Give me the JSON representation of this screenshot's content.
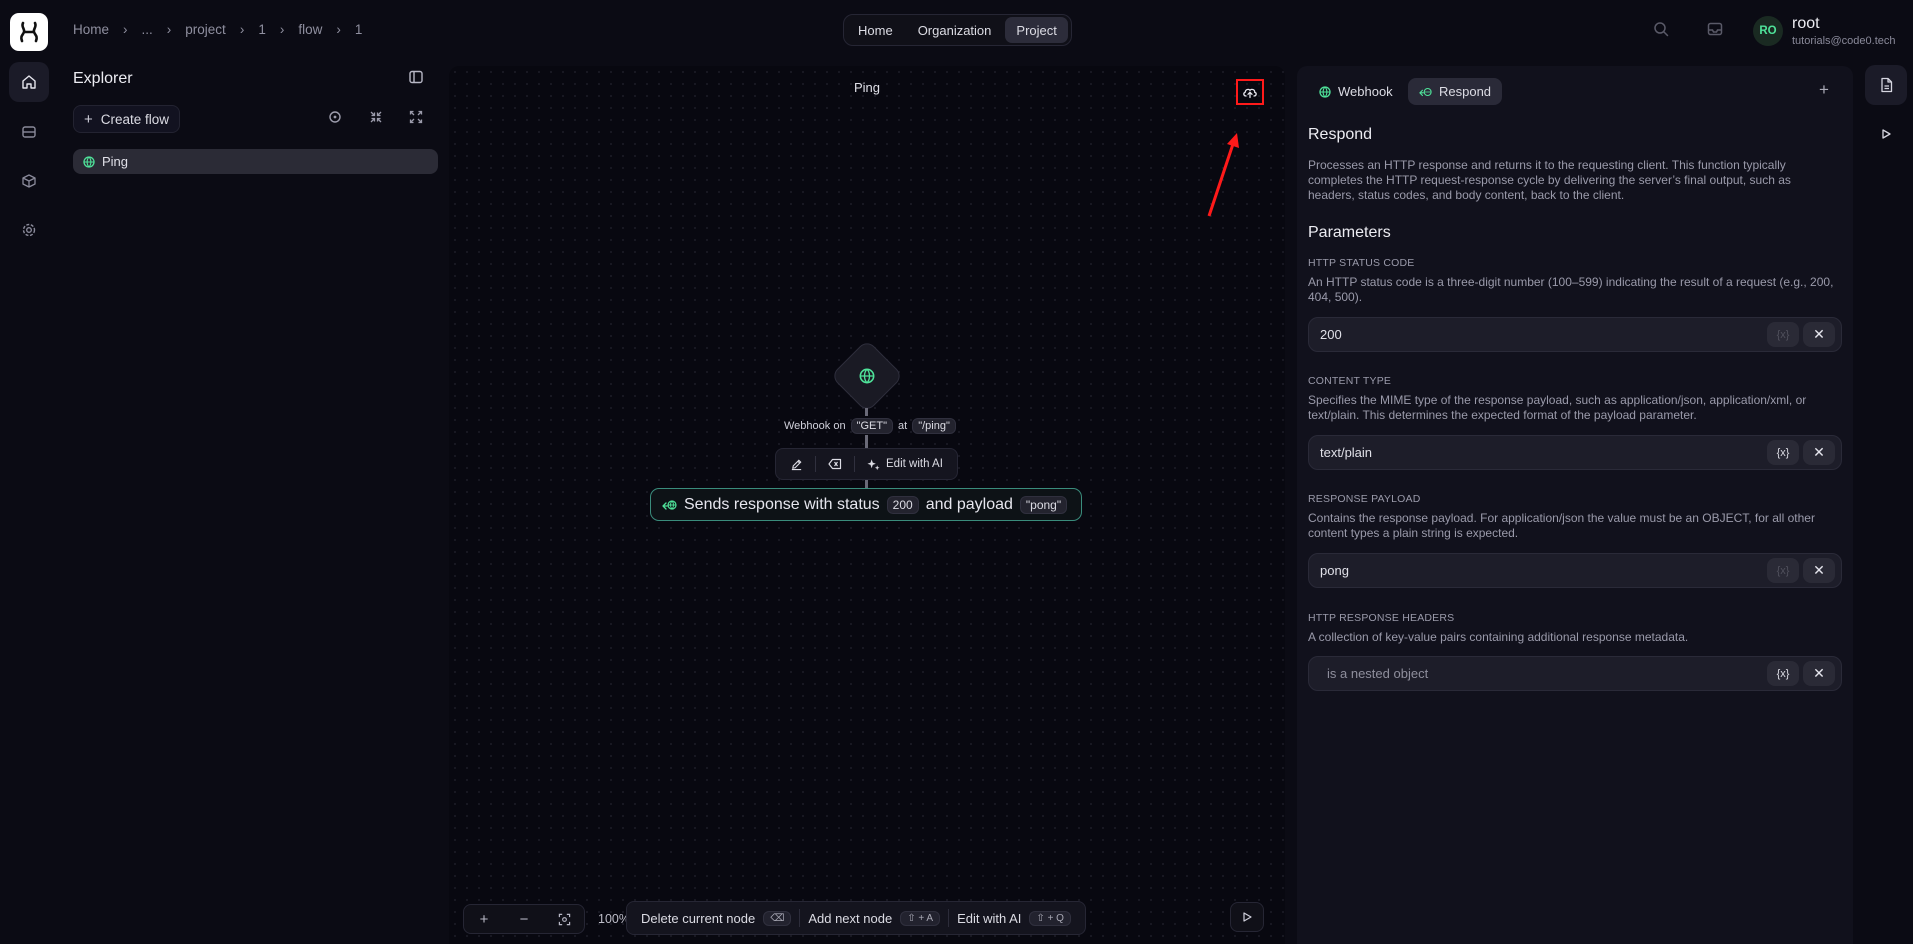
{
  "breadcrumb": [
    "Home",
    "...",
    "project",
    "1",
    "flow",
    "1"
  ],
  "topnav": [
    {
      "label": "Home",
      "active": false
    },
    {
      "label": "Organization",
      "active": false
    },
    {
      "label": "Project",
      "active": true
    }
  ],
  "user": {
    "initials": "RO",
    "name": "root",
    "email": "tutorials@code0.tech"
  },
  "explorer": {
    "title": "Explorer",
    "create_label": "Create flow",
    "flows": [
      {
        "name": "Ping",
        "icon": "webhook-icon"
      }
    ]
  },
  "canvas": {
    "title": "Ping",
    "webhook": {
      "prefix": "Webhook on",
      "method": "\"GET\"",
      "at": "at",
      "path": "\"/ping\""
    },
    "node_toolbar": {
      "edit_ai_label": "Edit with AI"
    },
    "respond": {
      "prefix": "Sends response with status",
      "status": "200",
      "middle": "and payload",
      "payload": "\"pong\""
    },
    "zoom": "100%",
    "shortcuts": [
      {
        "label": "Delete current node",
        "key": "⌫"
      },
      {
        "label": "Add next node",
        "key": "⇧ + A"
      },
      {
        "label": "Edit with AI",
        "key": "⇧ + Q"
      }
    ]
  },
  "panel": {
    "tabs": [
      {
        "label": "Webhook",
        "active": false
      },
      {
        "label": "Respond",
        "active": true
      }
    ],
    "title": "Respond",
    "description": "Processes an HTTP response and returns it to the requesting client. This function typically completes the HTTP request-response cycle by delivering the server’s final output, such as headers, status codes, and body content, back to the client.",
    "params_title": "Parameters",
    "params": [
      {
        "label": "HTTP STATUS CODE",
        "description": "An HTTP status code is a three-digit number (100–599) indicating the result of a request (e.g., 200, 404, 500).",
        "value": "200",
        "placeholder": ""
      },
      {
        "label": "CONTENT TYPE",
        "description": "Specifies the MIME type of the response payload, such as application/json, application/xml, or text/plain. This determines the expected format of the payload parameter.",
        "value": "text/plain",
        "placeholder": ""
      },
      {
        "label": "RESPONSE PAYLOAD",
        "description": "Contains the response payload. For application/json the value must be an OBJECT, for all other content types a plain string is expected.",
        "value": "pong",
        "placeholder": ""
      },
      {
        "label": "HTTP RESPONSE HEADERS",
        "description": "A collection of key-value pairs containing additional response metadata.",
        "value": "",
        "placeholder": "is a nested object"
      }
    ],
    "variable_glyph": "{x}",
    "clear_glyph": "✕"
  },
  "colors": {
    "accent": "#4fe39a",
    "node_border": "#3a8c7c",
    "highlight": "#ff1a1a"
  }
}
